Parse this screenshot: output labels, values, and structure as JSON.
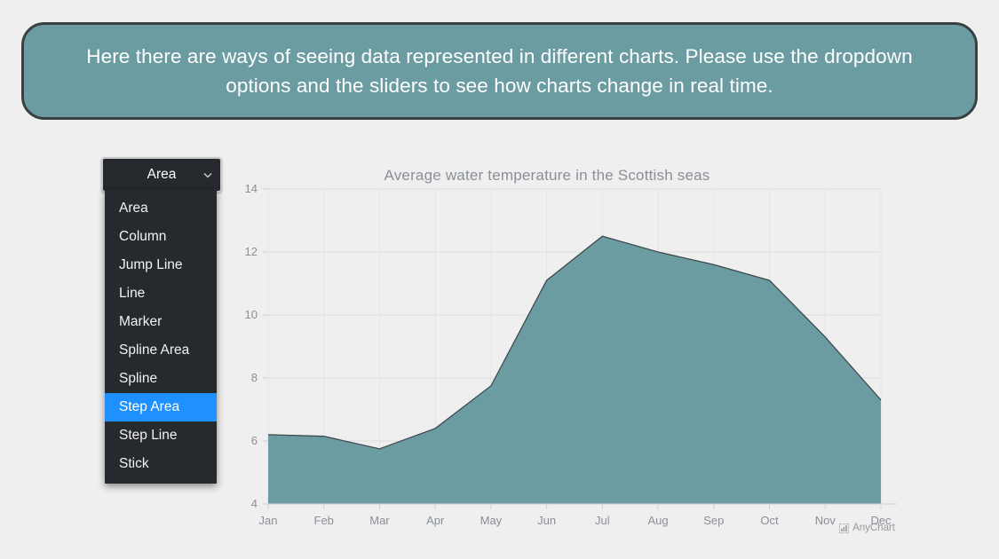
{
  "banner": {
    "text": "Here there are ways of seeing data represented in different charts. Please use the dropdown options and the sliders to see how charts change in real time."
  },
  "colors": {
    "banner_background": "#6b9ca2",
    "banner_border": "#3a3f44",
    "series_fill": "#6b9ca2",
    "series_stroke": "#3f4a4e",
    "dropdown_background": "#26292e",
    "dropdown_highlight": "#1e90ff",
    "page_background": "#efefef",
    "axis_text": "#8a8f98"
  },
  "dropdown": {
    "name": "chart-type-select",
    "selected": "Area",
    "chevron_icon": "chevron-down-icon",
    "expanded": true,
    "highlighted": "Step Area",
    "options": [
      "Area",
      "Column",
      "Jump Line",
      "Line",
      "Marker",
      "Spline Area",
      "Spline",
      "Step Area",
      "Step Line",
      "Stick"
    ]
  },
  "credit": {
    "label": "AnyChart",
    "icon": "bar-chart-icon"
  },
  "chart_data": {
    "type": "area",
    "title": "Average water temperature in the Scottish seas",
    "xlabel": "",
    "ylabel": "",
    "categories": [
      "Jan",
      "Feb",
      "Mar",
      "Apr",
      "May",
      "Jun",
      "Jul",
      "Aug",
      "Sep",
      "Oct",
      "Nov",
      "Dec"
    ],
    "values": [
      6.2,
      6.15,
      5.75,
      6.4,
      7.75,
      11.1,
      12.5,
      12.0,
      11.6,
      11.1,
      9.3,
      7.3
    ],
    "ylim": [
      4,
      14
    ],
    "yticks": [
      4,
      6,
      8,
      10,
      12,
      14
    ],
    "grid": true,
    "legend": "none",
    "series_name": "Average water temperature"
  }
}
